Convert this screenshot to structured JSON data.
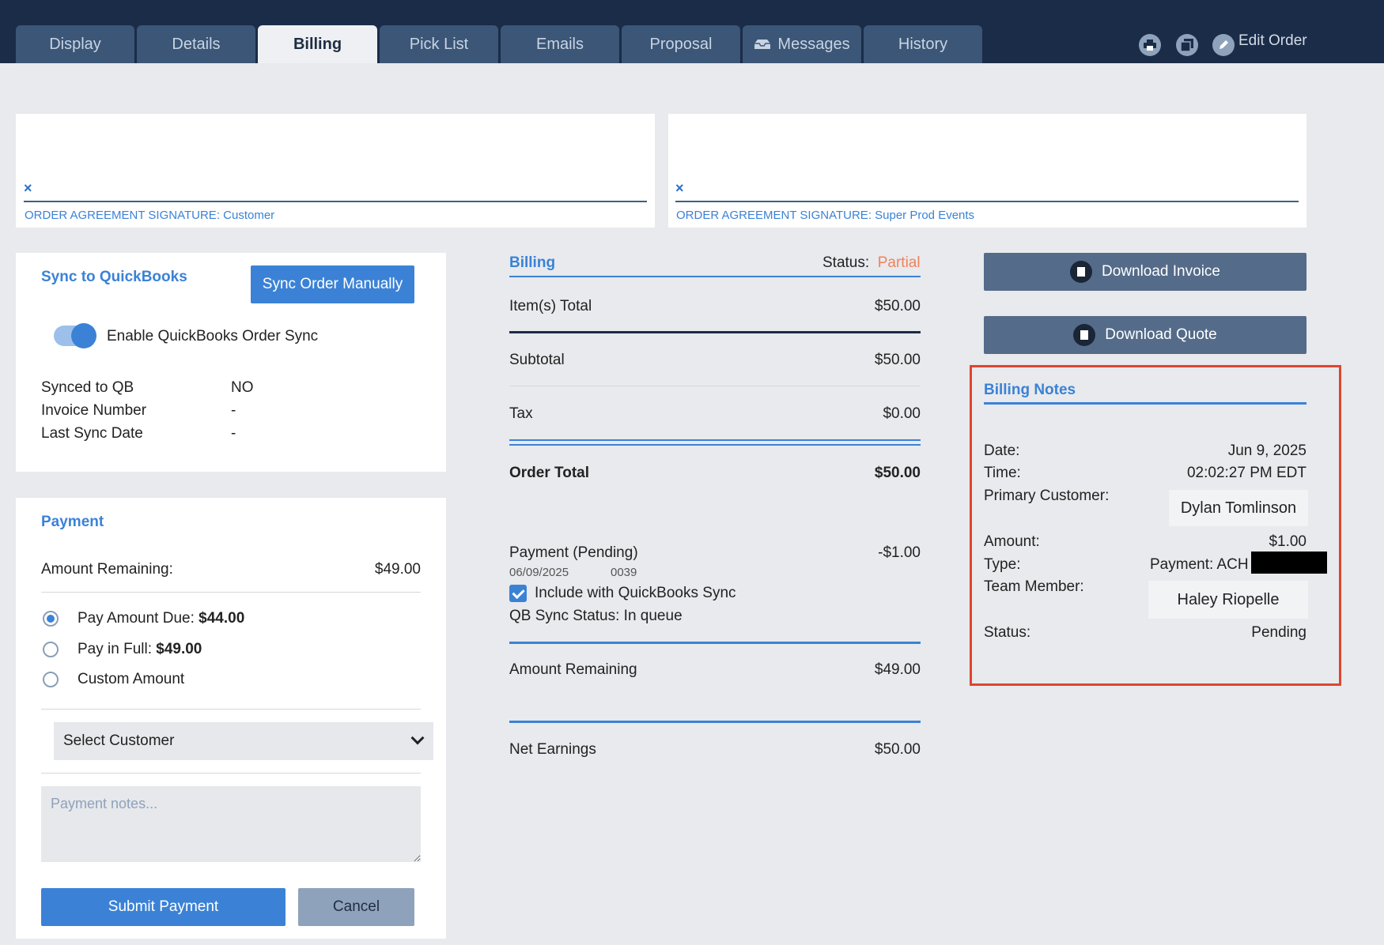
{
  "tabs": [
    {
      "label": "Display"
    },
    {
      "label": "Details"
    },
    {
      "label": "Billing"
    },
    {
      "label": "Pick List"
    },
    {
      "label": "Emails"
    },
    {
      "label": "Proposal"
    },
    {
      "label": "Messages"
    },
    {
      "label": "History"
    }
  ],
  "header": {
    "edit_order": "Edit Order"
  },
  "signatures": {
    "customer": "ORDER AGREEMENT SIGNATURE: Customer",
    "company": "ORDER AGREEMENT SIGNATURE: Super Prod Events",
    "x": "×"
  },
  "quickbooks": {
    "title": "Sync to QuickBooks",
    "sync_button": "Sync Order Manually",
    "toggle_label": "Enable QuickBooks Order Sync",
    "rows": [
      {
        "label": "Synced to QB",
        "value": "NO"
      },
      {
        "label": "Invoice Number",
        "value": "-"
      },
      {
        "label": "Last Sync Date",
        "value": "-"
      }
    ]
  },
  "payment": {
    "title": "Payment",
    "amount_remaining_label": "Amount Remaining:",
    "amount_remaining_value": "$49.00",
    "options": [
      {
        "label": "Pay Amount Due: ",
        "amount": "$44.00",
        "selected": true
      },
      {
        "label": "Pay in Full: ",
        "amount": "$49.00",
        "selected": false
      },
      {
        "label": "Custom Amount",
        "amount": "",
        "selected": false
      }
    ],
    "select_customer": "Select Customer",
    "notes_placeholder": "Payment notes...",
    "submit": "Submit Payment",
    "cancel": "Cancel"
  },
  "billing": {
    "title": "Billing",
    "status_label": "Status:",
    "status_value": "Partial",
    "items_total_label": "Item(s) Total",
    "items_total_value": "$50.00",
    "subtotal_label": "Subtotal",
    "subtotal_value": "$50.00",
    "tax_label": "Tax",
    "tax_value": "$0.00",
    "order_total_label": "Order Total",
    "order_total_value": "$50.00",
    "payment_label": "Payment (Pending)",
    "payment_value": "-$1.00",
    "payment_date": "06/09/2025",
    "payment_ref": "0039",
    "include_sync_label": "Include with QuickBooks Sync",
    "qb_sync_status": "QB Sync Status: In queue",
    "amount_remaining_label": "Amount Remaining",
    "amount_remaining_value": "$49.00",
    "net_earnings_label": "Net Earnings",
    "net_earnings_value": "$50.00"
  },
  "actions": {
    "download_invoice": "Download Invoice",
    "download_quote": "Download Quote"
  },
  "billing_notes": {
    "title": "Billing Notes",
    "date_label": "Date:",
    "date_value": "Jun 9, 2025",
    "time_label": "Time:",
    "time_value": "02:02:27 PM EDT",
    "primary_customer_label": "Primary Customer:",
    "primary_customer_value": "Dylan Tomlinson",
    "amount_label": "Amount:",
    "amount_value": "$1.00",
    "type_label": "Type:",
    "type_value": "Payment: ACH",
    "team_member_label": "Team Member:",
    "team_member_value": "Haley Riopelle",
    "status_label": "Status:",
    "status_value": "Pending"
  },
  "colors": {
    "header_bg": "#1b2c48",
    "accent": "#3b82d6",
    "status_partial": "#f0825b",
    "highlight_box": "#e0452f"
  }
}
